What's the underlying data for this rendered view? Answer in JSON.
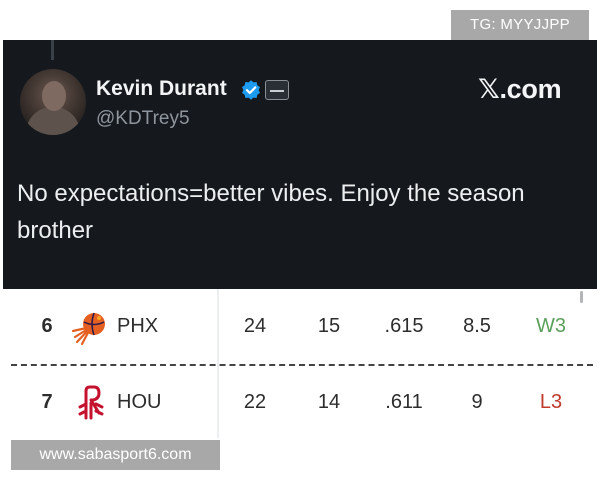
{
  "watermark_top": "TG: MYYJJPP",
  "watermark_bottom": "www.sabasport6.com",
  "tweet": {
    "display_name": "Kevin Durant",
    "handle": "@KDTrey5",
    "source_logo": "𝕏.com",
    "text": "No expectations=better vibes. Enjoy the season brother",
    "verified_color": "#1d9bf0"
  },
  "standings": {
    "rows": [
      {
        "rank": "6",
        "team": "PHX",
        "logo_icon": "suns-logo-icon",
        "w": "24",
        "l": "15",
        "pct": ".615",
        "gb": "8.5",
        "streak": "W3",
        "streak_type": "win"
      },
      {
        "rank": "7",
        "team": "HOU",
        "logo_icon": "rockets-logo-icon",
        "w": "22",
        "l": "14",
        "pct": ".611",
        "gb": "9",
        "streak": "L3",
        "streak_type": "loss"
      }
    ]
  },
  "colors": {
    "tweet_bg": "#15191e",
    "win": "#5aa05a",
    "loss": "#c0392b",
    "watermark_bg": "#a8a8a8"
  }
}
